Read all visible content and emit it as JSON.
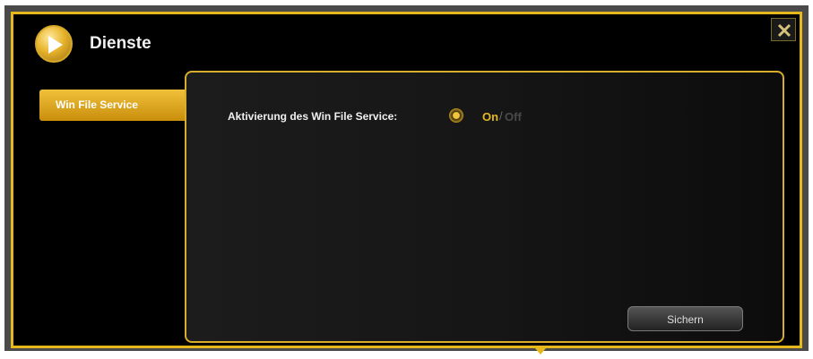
{
  "window": {
    "title": "Dienste",
    "logo_icon": "play-icon",
    "close_icon": "close-icon"
  },
  "sidebar": {
    "items": [
      {
        "label": "Win File Service",
        "active": true
      }
    ]
  },
  "main": {
    "activation": {
      "label": "Aktivierung des Win File Service:",
      "on_label": "On",
      "separator": "/",
      "off_label": "Off",
      "selected": "On"
    },
    "save_label": "Sichern"
  },
  "colors": {
    "accent": "#e6b81c",
    "background": "#000000",
    "panel": "#161616"
  }
}
